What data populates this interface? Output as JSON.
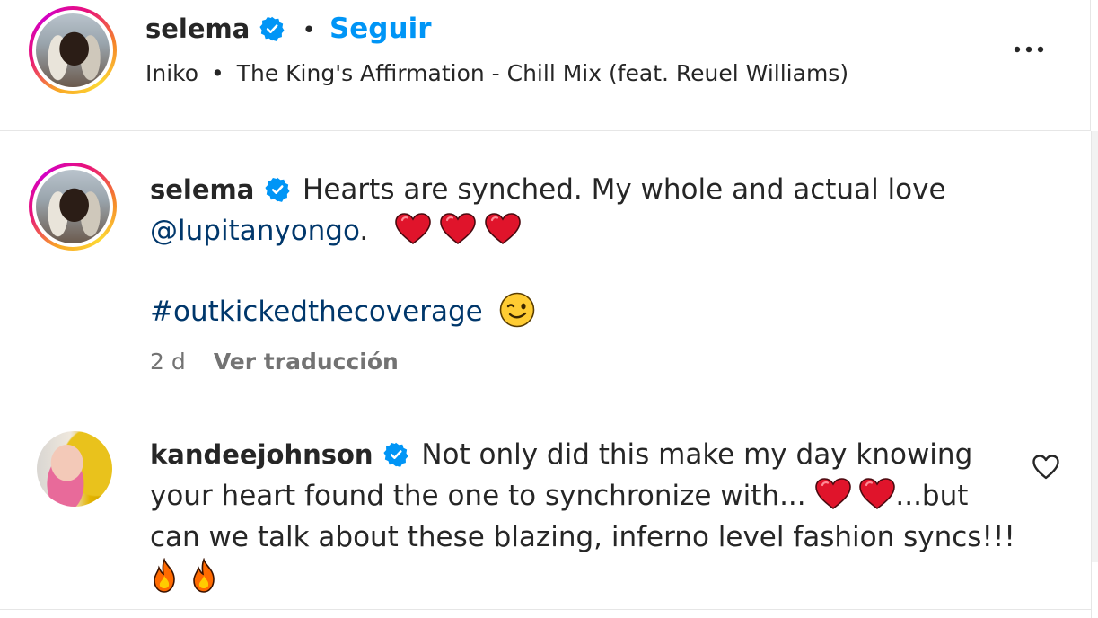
{
  "header": {
    "username": "selema",
    "separator": "•",
    "follow_label": "Seguir",
    "audio_artist": "Iniko",
    "audio_separator": "•",
    "audio_title": "The King's Affirmation - Chill Mix (feat. Reuel Williams)",
    "more_icon": "more-options-icon"
  },
  "caption": {
    "username": "selema",
    "text_part1": "Hearts are synched. My whole and actual love",
    "mention": "@lupitanyongo",
    "text_after_mention": ".",
    "hashtag": "#outkickedthecoverage",
    "time": "2 d",
    "translate_label": "Ver traducción"
  },
  "comments": [
    {
      "username": "kandeejohnson",
      "line1": "Not only did this make my day knowing",
      "line2": "your heart found the one to synchronize with...",
      "line2_after": "...but",
      "line3": "can we talk about these blazing, inferno level fashion syncs!!!",
      "like_icon": "heart-outline-icon"
    }
  ],
  "colors": {
    "link": "#00376b",
    "follow": "#0095f6",
    "verified": "#0095f6",
    "heart_emoji": "#e0142b",
    "fire_emoji": "#ff6a00"
  }
}
